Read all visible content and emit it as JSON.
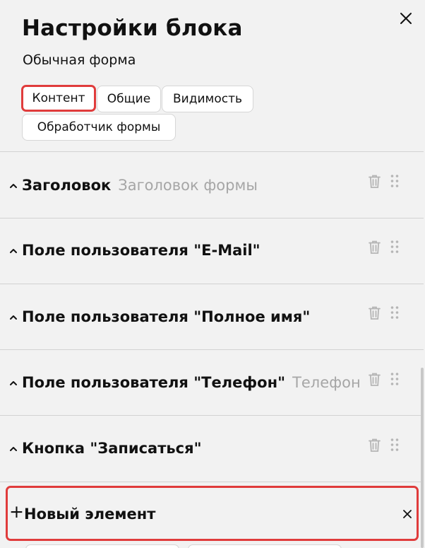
{
  "header": {
    "title": "Настройки блока",
    "subtitle": "Обычная форма"
  },
  "icons": {
    "close": "close-icon",
    "chevron": "chevron-up-icon",
    "trash": "trash-icon",
    "drag": "drag-handle-icon",
    "plus": "plus-icon"
  },
  "tabs": [
    {
      "label": "Контент",
      "active": true
    },
    {
      "label": "Общие",
      "active": false
    },
    {
      "label": "Видимость",
      "active": false
    },
    {
      "label": "Обработчик формы",
      "active": false
    }
  ],
  "items": [
    {
      "label": "Заголовок",
      "sub": "Заголовок формы"
    },
    {
      "label": "Поле пользователя \"E-Mail\"",
      "sub": ""
    },
    {
      "label": "Поле пользователя \"Полное имя\"",
      "sub": ""
    },
    {
      "label": "Поле пользователя \"Телефон\"",
      "sub": "Телефон"
    },
    {
      "label": "Кнопка \"Записаться\"",
      "sub": ""
    }
  ],
  "new_element": {
    "plus": "+",
    "label": "Новый элемент"
  },
  "colors": {
    "highlight": "#e03c3c",
    "background": "#f2f2f2",
    "muted_text": "#a6a6a6",
    "icon_gray": "#b5b5b5"
  }
}
